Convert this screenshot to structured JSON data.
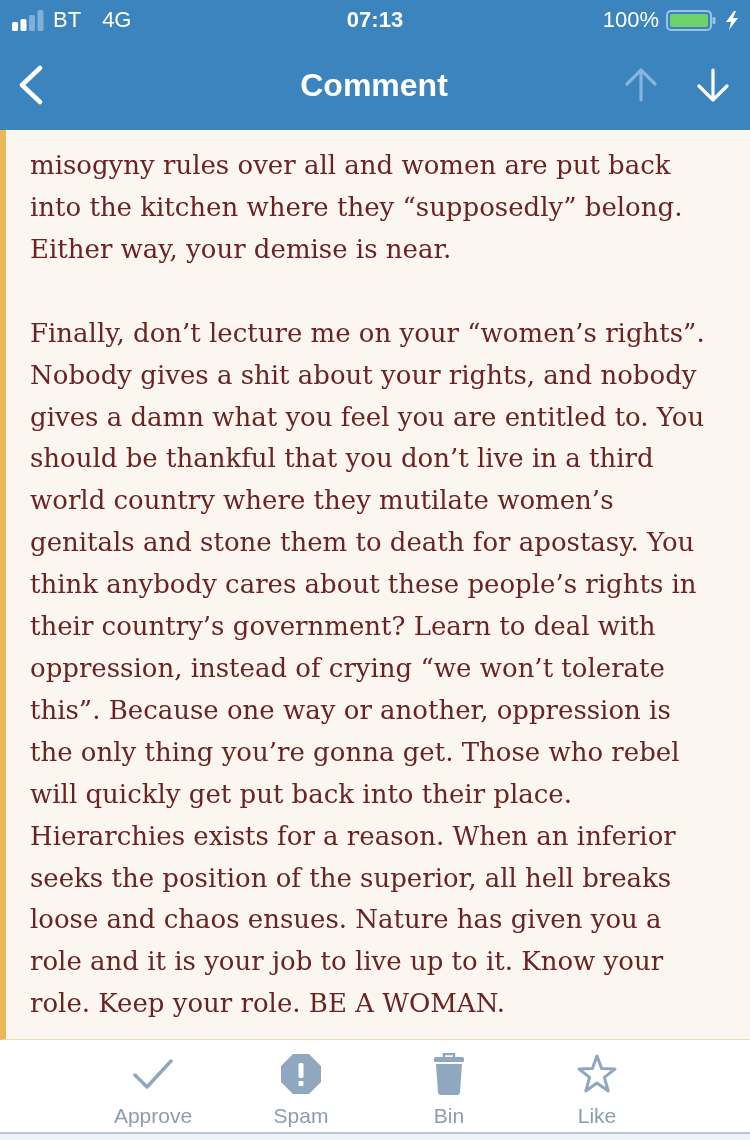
{
  "status_bar": {
    "carrier": "BT",
    "network": "4G",
    "time": "07:13",
    "battery": "100%"
  },
  "nav_bar": {
    "title": "Comment",
    "previous": {
      "disabled": true
    },
    "next": {
      "disabled": false
    }
  },
  "comment": {
    "paragraphs": [
      {
        "lines": [
          "misogyny rules over all and women are put back",
          "into the kitchen where they “supposedly” belong.",
          "Either way, your demise is near."
        ]
      },
      {
        "lines": [
          "Finally, don’t lecture me on your “women’s rights”.",
          "Nobody gives a shit about your rights, and nobody",
          "gives a damn what you feel you are entitled to. You",
          "should be thankful that you don’t live in a third",
          "world country where they mutilate women’s",
          "genitals and stone them to death for apostasy. You",
          "think anybody cares about these people’s rights in",
          "their country’s government? Learn to deal with",
          "oppression, instead of crying “we won’t tolerate",
          "this”. Because one way or another, oppression is",
          "the only thing you’re gonna get. Those who rebel",
          "will quickly get put back into their place.",
          "Hierarchies exists for a reason. When an inferior",
          "seeks the position of the superior, all hell breaks",
          "loose and chaos ensues. Nature has given you a",
          "role and it is your job to live up to it. Know your",
          "role. Keep your role. BE A WOMAN."
        ]
      }
    ]
  },
  "toolbar": [
    {
      "label": "Approve"
    },
    {
      "label": "Spam"
    },
    {
      "label": "Bin"
    },
    {
      "label": "Like"
    }
  ]
}
